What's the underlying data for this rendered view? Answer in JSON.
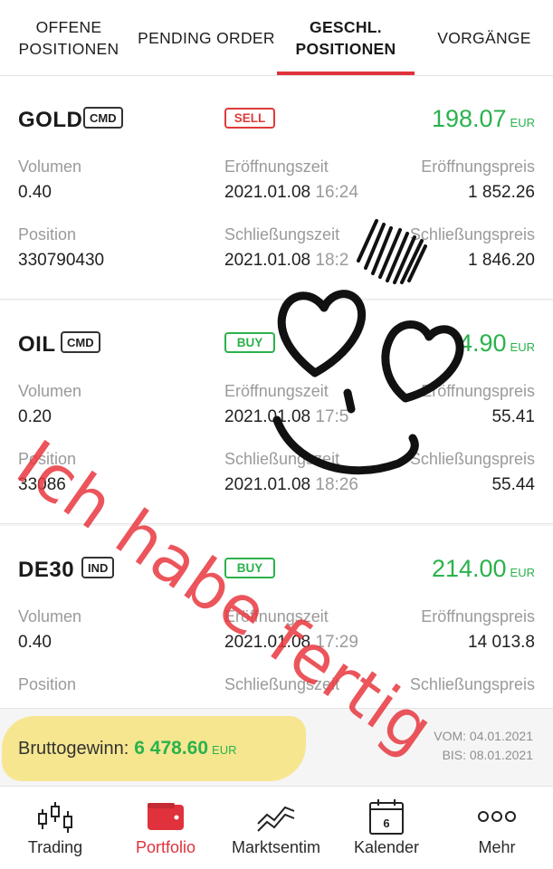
{
  "tabs": [
    {
      "line1": "OFFENE",
      "line2": "POSITIONEN",
      "active": false
    },
    {
      "line1": "PENDING ORDER",
      "line2": "",
      "active": false
    },
    {
      "line1": "GESCHL.",
      "line2": "POSITIONEN",
      "active": true
    },
    {
      "line1": "VORGÄNGE",
      "line2": "",
      "active": false
    }
  ],
  "labels": {
    "volume": "Volumen",
    "position": "Position",
    "open_time": "Eröffnungszeit",
    "close_time": "Schließungszeit",
    "open_price": "Eröffnungspreis",
    "close_price": "Schließungspreis"
  },
  "positions": [
    {
      "symbol": "GOLD",
      "type_badge": "CMD",
      "direction": "SELL",
      "profit": "198.07",
      "currency": "EUR",
      "volume": "0.40",
      "position": "330790430",
      "open_date": "2021.01.08",
      "open_clock": "16:24",
      "close_date": "2021.01.08",
      "close_clock": "18:2",
      "open_price": "1 852.26",
      "close_price": "1 846.20"
    },
    {
      "symbol": "OIL",
      "type_badge": "CMD",
      "direction": "BUY",
      "profit": "4.90",
      "currency": "EUR",
      "volume": "0.20",
      "position": "33086",
      "open_date": "2021.01.08",
      "open_clock": "17:5",
      "close_date": "2021.01.08",
      "close_clock": "18:26",
      "open_price": "55.41",
      "close_price": "55.44"
    },
    {
      "symbol": "DE30",
      "type_badge": "IND",
      "direction": "BUY",
      "profit": "214.00",
      "currency": "EUR",
      "volume": "0.40",
      "position": "",
      "open_date": "2021.01.08",
      "open_clock": "17:29",
      "close_date": "",
      "close_clock": "",
      "open_price": "14 013.8",
      "close_price": ""
    }
  ],
  "summary": {
    "gross_label": "Bruttogewinn:",
    "gross_value": "6 478.60",
    "currency": "EUR",
    "from": "VOM: 04.01.2021",
    "to": "BIS: 08.01.2021"
  },
  "nav": [
    {
      "label": "Trading",
      "icon": "candlestick-icon",
      "active": false
    },
    {
      "label": "Portfolio",
      "icon": "wallet-icon",
      "active": true
    },
    {
      "label": "Marktsentim",
      "icon": "market-sentiment-icon",
      "active": false
    },
    {
      "label": "Kalender",
      "icon": "calendar-icon",
      "calendar_day": "6",
      "active": false
    },
    {
      "label": "Mehr",
      "icon": "more-dots-icon",
      "active": false
    }
  ],
  "overlay": {
    "handwriting": "Ich habe fertig",
    "doodle": "heart-eyes-smiley-icon",
    "highlight_color": "#f6e58a"
  },
  "colors": {
    "accent_red": "#e0323c",
    "profit_green": "#2bb24c",
    "sell_red": "#e03a3a"
  }
}
